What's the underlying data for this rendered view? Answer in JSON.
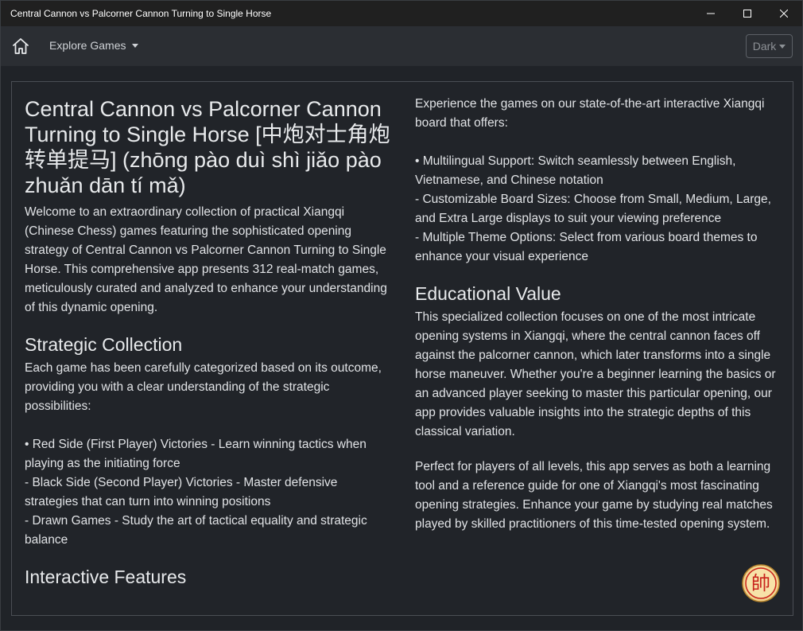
{
  "window": {
    "title": "Central Cannon vs Palcorner Cannon Turning to Single Horse"
  },
  "navbar": {
    "explore_label": "Explore Games",
    "theme_label": "Dark"
  },
  "icons": {
    "home": "home-icon",
    "minimize": "minimize-icon",
    "maximize": "maximize-icon",
    "close": "close-icon",
    "badge": "xiangqi-general-piece-icon"
  },
  "colors": {
    "background": "#202328",
    "navbar": "#2b2e33",
    "text": "#e4e6e8",
    "piece_fill": "#f7e2a8",
    "piece_red": "#c8221b"
  },
  "content": {
    "title": "Central Cannon vs Palcorner Cannon Turning to Single Horse [中炮对士角炮转单提马] (zhōng pào duì shì jiǎo pào zhuǎn dān tí mǎ)",
    "intro": "Welcome to an extraordinary collection of practical Xiangqi (Chinese Chess) games featuring the sophisticated opening strategy of Central Cannon vs Palcorner Cannon Turning to Single Horse. This comprehensive app presents 312 real-match games, meticulously curated and analyzed to enhance your understanding of this dynamic opening.",
    "strategic_heading": "Strategic Collection",
    "strategic_text": "Each game has been carefully categorized based on its outcome, providing you with a clear understanding of the strategic possibilities:",
    "strategic_items": [
      "• Red Side (First Player) Victories - Learn winning tactics when playing as the initiating force",
      "- Black Side (Second Player) Victories - Master defensive strategies that can turn into winning positions",
      "- Drawn Games - Study the art of tactical equality and strategic balance"
    ],
    "interactive_heading": "Interactive Features",
    "interactive_text": "Experience the games on our state-of-the-art interactive Xiangqi board that offers:",
    "interactive_items": [
      "• Multilingual Support: Switch seamlessly between English, Vietnamese, and Chinese notation",
      "- Customizable Board Sizes: Choose from Small, Medium, Large, and Extra Large displays to suit your viewing preference",
      "- Multiple Theme Options: Select from various board themes to enhance your visual experience"
    ],
    "educational_heading": "Educational Value",
    "educational_text": "This specialized collection focuses on one of the most intricate opening systems in Xiangqi, where the central cannon faces off against the palcorner cannon, which later transforms into a single horse maneuver. Whether you're a beginner learning the basics or an advanced player seeking to master this particular opening, our app provides valuable insights into the strategic depths of this classical variation.",
    "closing_text": "Perfect for players of all levels, this app serves as both a learning tool and a reference guide for one of Xiangqi's most fascinating opening strategies. Enhance your game by studying real matches played by skilled practitioners of this time-tested opening system.",
    "badge_char": "帥"
  }
}
